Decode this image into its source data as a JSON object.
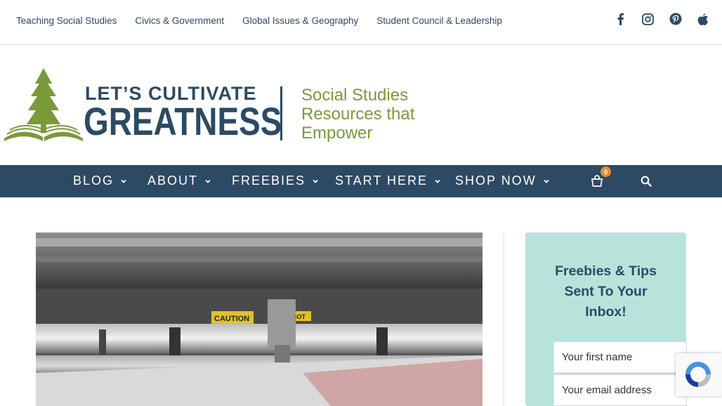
{
  "topnav": {
    "links": [
      "Teaching Social Studies",
      "Civics & Government",
      "Global Issues & Geography",
      "Student Council & Leadership"
    ]
  },
  "social": [
    "facebook-icon",
    "instagram-icon",
    "pinterest-icon",
    "apple-icon"
  ],
  "logo": {
    "line1": "LET’S CULTIVATE",
    "line2": "GREATNESS",
    "tagline": [
      "Social Studies",
      "Resources that",
      "Empower"
    ]
  },
  "mainnav": {
    "items": [
      "BLOG",
      "ABOUT",
      "FREEBIES",
      "START HERE",
      "SHOP NOW"
    ],
    "cart_count": "0"
  },
  "hero": {
    "caution_1": "CAUTION",
    "caution_2": "BOT"
  },
  "sidebar": {
    "heading": "Freebies & Tips Sent To Your Inbox!",
    "first_name_placeholder": "Your first name",
    "email_placeholder": "Your email address"
  },
  "colors": {
    "navy": "#2c4a64",
    "green": "#7a9a3a",
    "mint": "#b8e3db",
    "badge": "#e58d2d"
  }
}
